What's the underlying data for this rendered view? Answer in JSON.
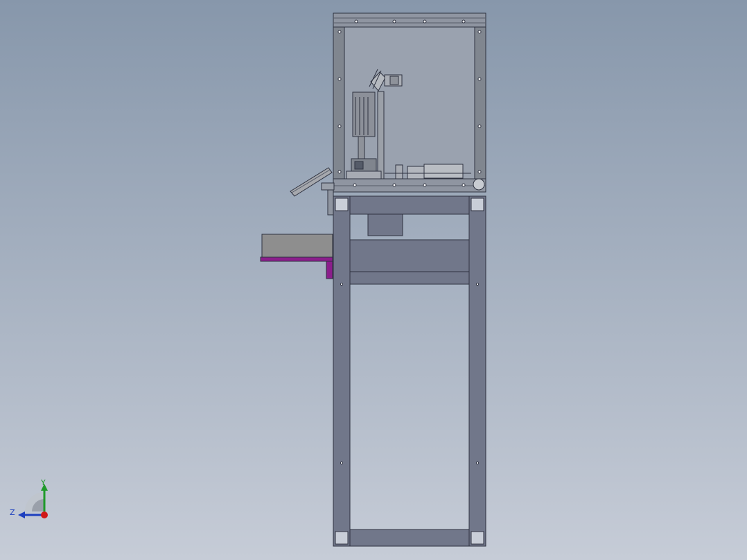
{
  "viewport": {
    "background_top": "#8797ab",
    "background_bottom": "#c6ccd7"
  },
  "model": {
    "frame_color": "#71778a",
    "frame_edge": "#2e3240",
    "enclosure_glass": "#9aa2af",
    "tray_color": "#8e8e8e",
    "bracket_color": "#8b1e8b",
    "panel_color": "#a6a8ad"
  },
  "triad": {
    "y_label": "Y",
    "z_label": "Z",
    "y_color": "#1f9a2a",
    "z_color": "#1d3fbf",
    "x_color": "#d01818"
  }
}
